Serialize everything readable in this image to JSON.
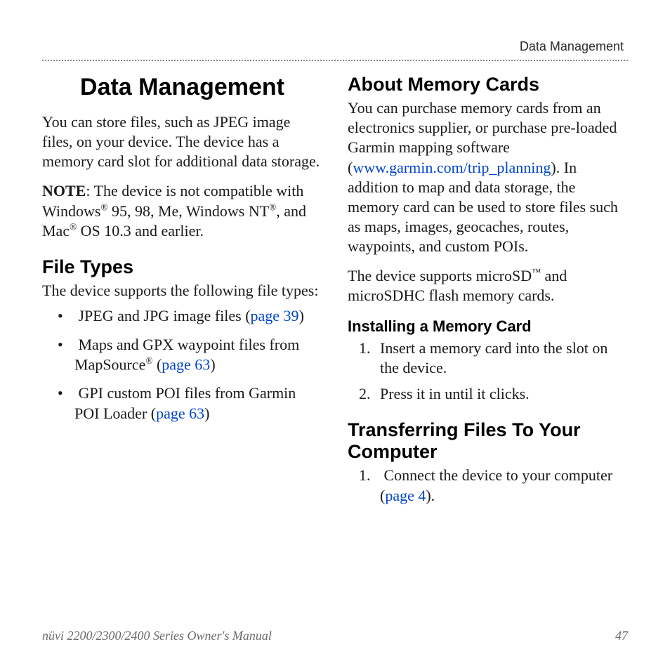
{
  "header_label": "Data Management",
  "title": "Data Management",
  "intro_p1": "You can store files, such as JPEG image files, on your device. The device has a memory card slot for additional data storage.",
  "note_label": "NOTE",
  "note_body_a": ": The device is not compatible with Windows",
  "note_body_b": " 95, 98, Me, Windows NT",
  "note_body_c": ", and Mac",
  "note_body_d": " OS 10.3 and earlier.",
  "filetypes_heading": "File Types",
  "filetypes_intro": "The device supports the following file types:",
  "ft1_a": "JPEG and JPG image files (",
  "ft1_link": "page 39",
  "ft1_b": ")",
  "ft2_a": "Maps and GPX waypoint files from MapSource",
  "ft2_b": " (",
  "ft2_link": "page 63",
  "ft2_c": ")",
  "ft3_a": "GPI custom POI files from Garmin POI Loader (",
  "ft3_link": "page 63",
  "ft3_b": ")",
  "aboutmem_heading": "About Memory Cards",
  "aboutmem_p1_a": "You can purchase memory cards from an electronics supplier, or purchase pre-loaded Garmin mapping software (",
  "aboutmem_link": "www.garmin.com/trip_planning",
  "aboutmem_p1_b": "). In addition to map and data storage, the memory card can be used to store files such as maps, images, geocaches, routes, waypoints, and custom POIs.",
  "aboutmem_p2_a": "The device supports microSD",
  "aboutmem_p2_b": " and microSDHC flash memory cards.",
  "install_heading": "Installing a Memory Card",
  "install_step1": "Insert a memory card into the slot on the device.",
  "install_step2": "Press it in until it clicks.",
  "transfer_heading": "Transferring Files To Your Computer",
  "transfer_step1_a": "Connect the device to your computer (",
  "transfer_step1_link": "page 4",
  "transfer_step1_b": ").",
  "footer_text": "nüvi 2200/2300/2400 Series Owner's Manual",
  "page_number": "47",
  "reg_mark": "®",
  "tm_mark": "™"
}
